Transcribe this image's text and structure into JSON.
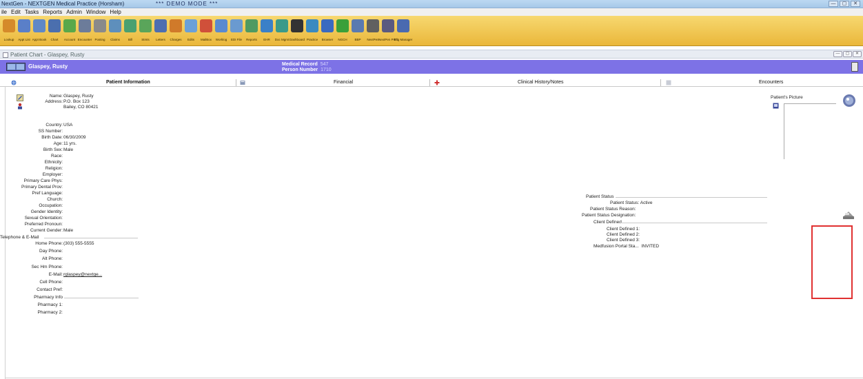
{
  "window": {
    "title": "NextGen - NEXTGEN Medical Practice (Horsham)",
    "demo_mode": "*** DEMO MODE ***",
    "controls": [
      "—",
      "▢",
      "✕"
    ]
  },
  "menu": [
    "ile",
    "Edit",
    "Tasks",
    "Reports",
    "Admin",
    "Window",
    "Help"
  ],
  "toolbar": [
    {
      "label": "Lookup",
      "icon": "lookup-icon",
      "color": "#d58a2a"
    },
    {
      "label": "Appt List",
      "icon": "appt-list-icon",
      "color": "#5a7fc8"
    },
    {
      "label": "Appt Book",
      "icon": "appt-book-icon",
      "color": "#5f88c7"
    },
    {
      "label": "Chart",
      "icon": "chart-icon",
      "color": "#4b6fae"
    },
    {
      "label": "Account",
      "icon": "account-icon",
      "color": "#59a84a"
    },
    {
      "label": "Encounter",
      "icon": "encounter-icon",
      "color": "#6c7c9a"
    },
    {
      "label": "Posting",
      "icon": "posting-icon",
      "color": "#8a8a8a"
    },
    {
      "label": "Claims",
      "icon": "claims-icon",
      "color": "#5e8fbc"
    },
    {
      "label": "Bill",
      "icon": "bill-icon",
      "color": "#4aa070"
    },
    {
      "label": "Stmts",
      "icon": "statements-icon",
      "color": "#5aa55a"
    },
    {
      "label": "Letters",
      "icon": "letters-icon",
      "color": "#4d6eb0"
    },
    {
      "label": "Charges",
      "icon": "charges-icon",
      "color": "#d07a2a"
    },
    {
      "label": "Edits",
      "icon": "edits-icon",
      "color": "#6aa0d8"
    },
    {
      "label": "MailBox",
      "icon": "mailbox-icon",
      "color": "#d0503a"
    },
    {
      "label": "Worklog",
      "icon": "worklog-icon",
      "color": "#5a8ad0"
    },
    {
      "label": "EDI File",
      "icon": "edi-file-icon",
      "color": "#6a9ad0"
    },
    {
      "label": "Reports",
      "icon": "reports-icon",
      "color": "#4f9a62"
    },
    {
      "label": "EHR",
      "icon": "ehr-icon",
      "color": "#3a80c8"
    },
    {
      "label": "Doc Mgmt",
      "icon": "doc-mgmt-icon",
      "color": "#3a9a8a"
    },
    {
      "label": "Dashboard",
      "icon": "dashboard-icon",
      "color": "#333333"
    },
    {
      "label": "Practice",
      "icon": "practice-icon",
      "color": "#3a8ac0"
    },
    {
      "label": "Browser",
      "icon": "browser-icon",
      "color": "#3a6ac0"
    },
    {
      "label": "NGCH",
      "icon": "ngch-icon",
      "color": "#3aa03a"
    },
    {
      "label": "BBP",
      "icon": "bbp-icon",
      "color": "#5a7ab0"
    },
    {
      "label": "NextPen",
      "icon": "nextpen-icon",
      "color": "#606060"
    },
    {
      "label": "NextPen Print",
      "icon": "nextpen-print-icon",
      "color": "#5a5a80"
    },
    {
      "label": "Elig Manager",
      "icon": "elig-manager-icon",
      "color": "#4a6ab0"
    }
  ],
  "subwindow": {
    "title": "Patient Chart - Glaspey, Rusty"
  },
  "banner": {
    "patient_name": "Glaspey, Rusty",
    "medical_record_label": "Medical Record",
    "medical_record_value": "547",
    "person_number_label": "Person Number",
    "person_number_value": "1710"
  },
  "tabs": [
    "Patient Information",
    "Financial",
    "Clinical History/Notes",
    "Encounters"
  ],
  "patient": {
    "name_label": "Name:",
    "name": "Glaspey, Rusty",
    "address_label": "Address:",
    "address1": "P.O. Box 123",
    "address2": "Bailey, CO 80421",
    "country_label": "Country:",
    "country": "USA",
    "ssn_label": "SS Number:",
    "birth_label": "Birth Date:",
    "birth": "06/30/2009",
    "age_label": "Age:",
    "age": "11 yrs.",
    "birth_sex_label": "Birth Sex:",
    "birth_sex": "Male",
    "race_label": "Race:",
    "ethnicity_label": "Ethnicity:",
    "religion_label": "Religion:",
    "employer_label": "Employer:",
    "pcp_label": "Primary Care Phys:",
    "dental_label": "Primary Dental Prov:",
    "language_label": "Pref Language:",
    "church_label": "Church:",
    "occupation_label": "Occupation:",
    "gender_identity_label": "Gender Identity:",
    "sexual_orientation_label": "Sexual Orientation:",
    "preferred_pronoun_label": "Preferred Pronoun:",
    "current_gender_label": "Current Gender:",
    "current_gender": "Male",
    "telephone_section": "Telephone & E-Mail",
    "home_phone_label": "Home Phone:",
    "home_phone": "(303) 555-5555",
    "day_phone_label": "Day Phone:",
    "alt_phone_label": "Alt Phone:",
    "sec_hm_phone_label": "Sec Hm Phone:",
    "email_label": "E-Mail:",
    "email": "rglaspey@nextge...",
    "cell_phone_label": "Cell Phone:",
    "contact_pref_label": "Contact Pref:",
    "pharmacy_section": "Pharmacy Info",
    "pharmacy1_label": "Pharmacy 1:",
    "pharmacy2_label": "Pharmacy 2:"
  },
  "status": {
    "section": "Patient Status",
    "status_label": "Patient Status:",
    "status": "Active",
    "reason_label": "Patient Status Reason:",
    "designation_label": "Patient Status Designation:",
    "client_section": "Client Defined",
    "client1_label": "Client Defined 1:",
    "client2_label": "Client Defined 2:",
    "client3_label": "Client Defined 3:",
    "medfusion_label": "Medfusion Portal Sta...",
    "medfusion": "INVITED"
  },
  "picture": {
    "label": "Patient's Picture"
  },
  "colors": {
    "banner": "#7d72e6",
    "toolbar": "#eab73a",
    "highlight": "#e03030",
    "link": "#1533b5"
  }
}
